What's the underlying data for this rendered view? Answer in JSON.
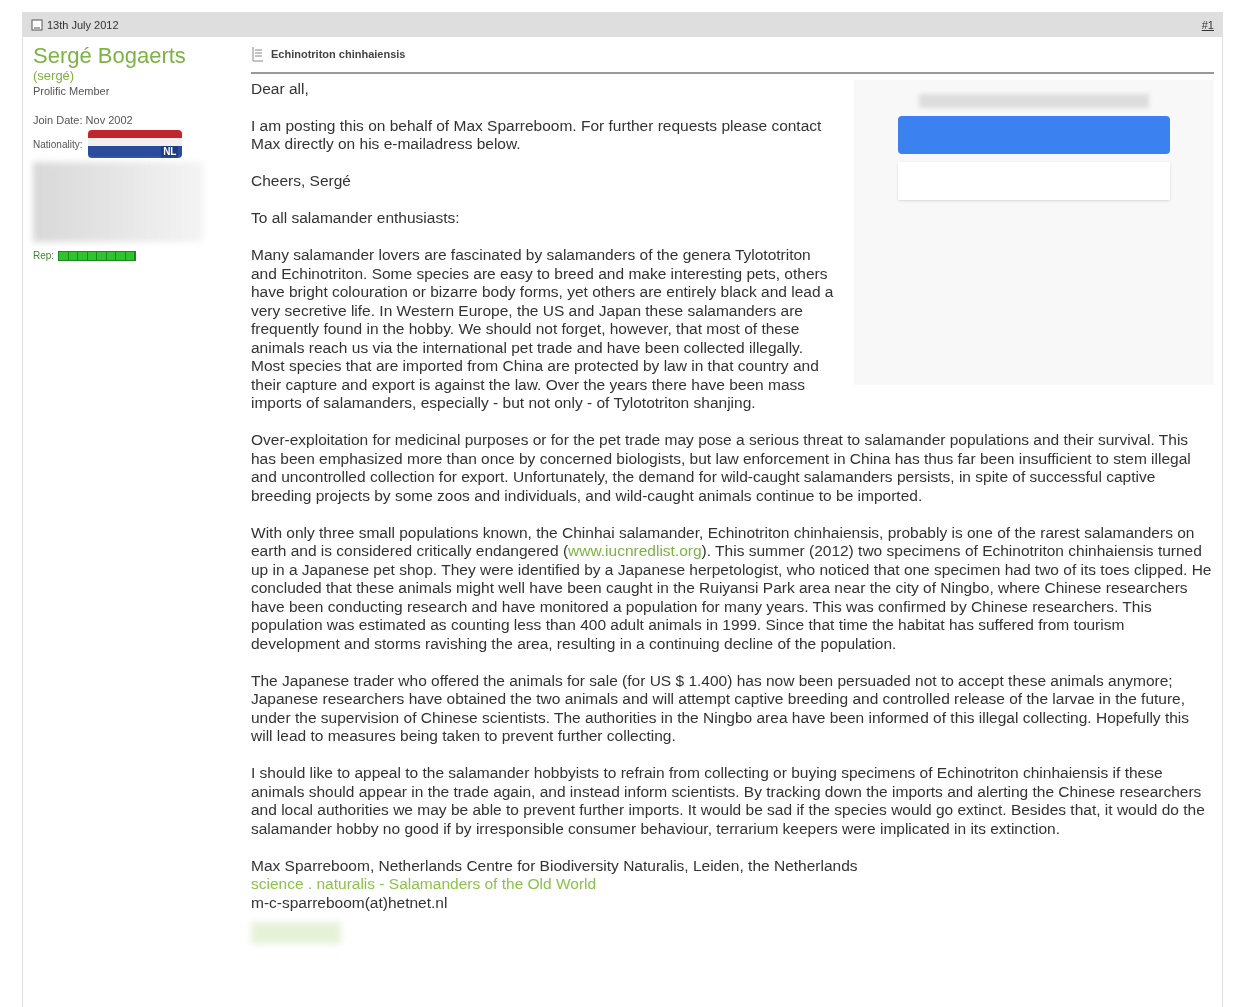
{
  "post_header": {
    "date": "13th July 2012",
    "post_number": "#1"
  },
  "author": {
    "name": "Sergé Bogaerts",
    "username": "(sergé)",
    "rank": "Prolific Member",
    "join_date": "Join Date: Nov 2002",
    "nationality_label": "Nationality:",
    "flag_code": "NL",
    "rep_label": "Rep:",
    "rep_meter": {
      "level": 1
    }
  },
  "post": {
    "title": "Echinotriton chinhaiensis",
    "paragraphs": [
      {
        "parts": [
          {
            "text": "Dear all,"
          }
        ]
      },
      {
        "parts": [
          {
            "text": "I am posting this on behalf of Max Sparreboom. For further requests please contact Max directly on his e-mailadress below."
          }
        ]
      },
      {
        "parts": [
          {
            "text": "Cheers, Sergé"
          }
        ]
      },
      {
        "parts": [
          {
            "text": "To all salamander enthusiasts:"
          }
        ]
      },
      {
        "parts": [
          {
            "text": "Many salamander lovers are fascinated by salamanders of the genera Tylototriton and Echinotriton. Some species are easy to breed and make interesting pets, others have bright colouration or bizarre body forms, yet others are entirely black and lead a very secretive life. In Western Europe, the US and Japan these salamanders are frequently found in the hobby. We should not forget, however, that most of these animals reach us via the international pet trade and have been collected illegally. Most species that are imported from China are protected by law in that country and their capture and export is against the law. Over the years there have been mass imports of salamanders, especially - but not only - of Tylototriton shanjing."
          }
        ]
      },
      {
        "parts": [
          {
            "text": "Over-exploitation for medicinal purposes or for the pet trade may pose a serious threat to salamander populations and their survival. This has been emphasized more than once by concerned biologists, but law enforcement in China has thus far been insufficient to stem illegal and uncontrolled collection for export. Unfortunately, the demand for wild-caught salamanders persists, in spite of successful captive breeding projects by some zoos and individuals, and wild-caught animals continue to be imported."
          }
        ]
      },
      {
        "parts": [
          {
            "text": "With only three small populations known, the Chinhai salamander, Echinotriton chinhaiensis, probably is one of the rarest salamanders on earth and is considered critically endangered ("
          },
          {
            "text": "www.iucnredlist.org",
            "kind": "link"
          },
          {
            "text": "). This summer (2012) two specimens of Echinotriton chinhaiensis turned up in a Japanese pet shop. They were identified by a Japanese herpetologist, who noticed that one specimen had two of its toes clipped. He concluded that these animals might well have been caught in the Ruiyansi Park area near the city of Ningbo, where Chinese researchers have been conducting research and have monitored a population for many years. This was confirmed by Chinese researchers. This population was estimated as counting less than 400 adult animals in 1999. Since that time the habitat has suffered from tourism development and storms ravishing the area, resulting in a continuing decline of the population."
          }
        ]
      },
      {
        "parts": [
          {
            "text": "The Japanese trader who offered the animals for sale (for US $ 1.400) has now been persuaded not to accept these animals anymore; Japanese researchers have obtained the two animals and will attempt captive breeding and controlled release of the larvae in the future, under the supervision of Chinese scientists. The authorities in the Ningbo area have been informed of this illegal collecting. Hopefully this will lead to measures being taken to prevent further collecting."
          }
        ]
      },
      {
        "parts": [
          {
            "text": "I should like to appeal to the salamander hobbyists to refrain from collecting or buying specimens of Echinotriton chinhaiensis if these animals should appear in the trade again, and instead inform scientists. By tracking down the imports and alerting the Chinese researchers and local authorities we may be able to prevent further imports. It would be sad if the species would go extinct. Besides that, it would do the salamander hobby no good if by irresponsible consumer behaviour, terrarium keepers were implicated in its extinction."
          }
        ]
      }
    ],
    "signature": {
      "name_line": "Max Sparreboom, Netherlands Centre for Biodiversity Naturalis, Leiden, the Netherlands",
      "link_line": "science . naturalis - Salamanders of the Old World",
      "email_line": "m-c-sparreboom(at)hetnet.nl"
    }
  }
}
